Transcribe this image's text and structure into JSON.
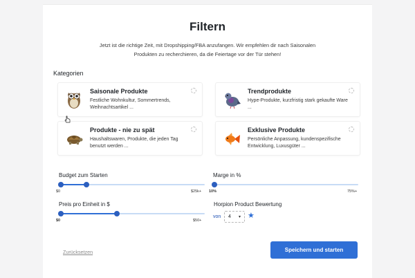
{
  "page": {
    "title": "Filtern",
    "intro": "Jetzt ist die richtige Zeit, mit Dropshipping/FBA anzufangen. Wir empfehlen dir nach Saisonalen Produkten zu recherchieren, da die Feiertage vor der Tür stehen!"
  },
  "categories": {
    "label": "Kategorien",
    "items": [
      {
        "title": "Saisonale Produkte",
        "description": "Festliche Wohnkultur, Sommertrends, Weihnachtsartikel ...",
        "icon": "owl-icon"
      },
      {
        "title": "Trendprodukte",
        "description": "Hype-Produkte, kurzfristig stark gekaufte Ware ...",
        "icon": "pigeon-icon"
      },
      {
        "title": "Produkte - nie zu spät",
        "description": "Haushaltswaren, Produkte, die jeden Tag benutzt werden ...",
        "icon": "turtle-icon"
      },
      {
        "title": "Exklusive Produkte",
        "description": "Persönliche Anpassung, kundenspezifische Entwicklung, Luxusgüter ...",
        "icon": "goldfish-icon"
      }
    ]
  },
  "sliders": {
    "budget": {
      "label": "Budget zum Starten",
      "min_label": "$0",
      "max_label": "$25k+",
      "range": [
        0,
        0.18
      ]
    },
    "margin": {
      "label": "Marge in %",
      "min_label": "10%",
      "max_label": "75%+",
      "range": [
        0,
        0
      ]
    },
    "price": {
      "label": "Preis pro Einheit in $",
      "min_label": "$0",
      "max_label": "$50+",
      "range": [
        0,
        0.39
      ]
    }
  },
  "rating": {
    "label": "Horpion Product Bewertung",
    "prefix": "von",
    "value": "4",
    "star": "★"
  },
  "actions": {
    "reset_label": "Zurücksetzen",
    "save_label": "Speichern und starten"
  },
  "colors": {
    "accent": "#2f6fd6",
    "track": "#c7dbf5"
  }
}
